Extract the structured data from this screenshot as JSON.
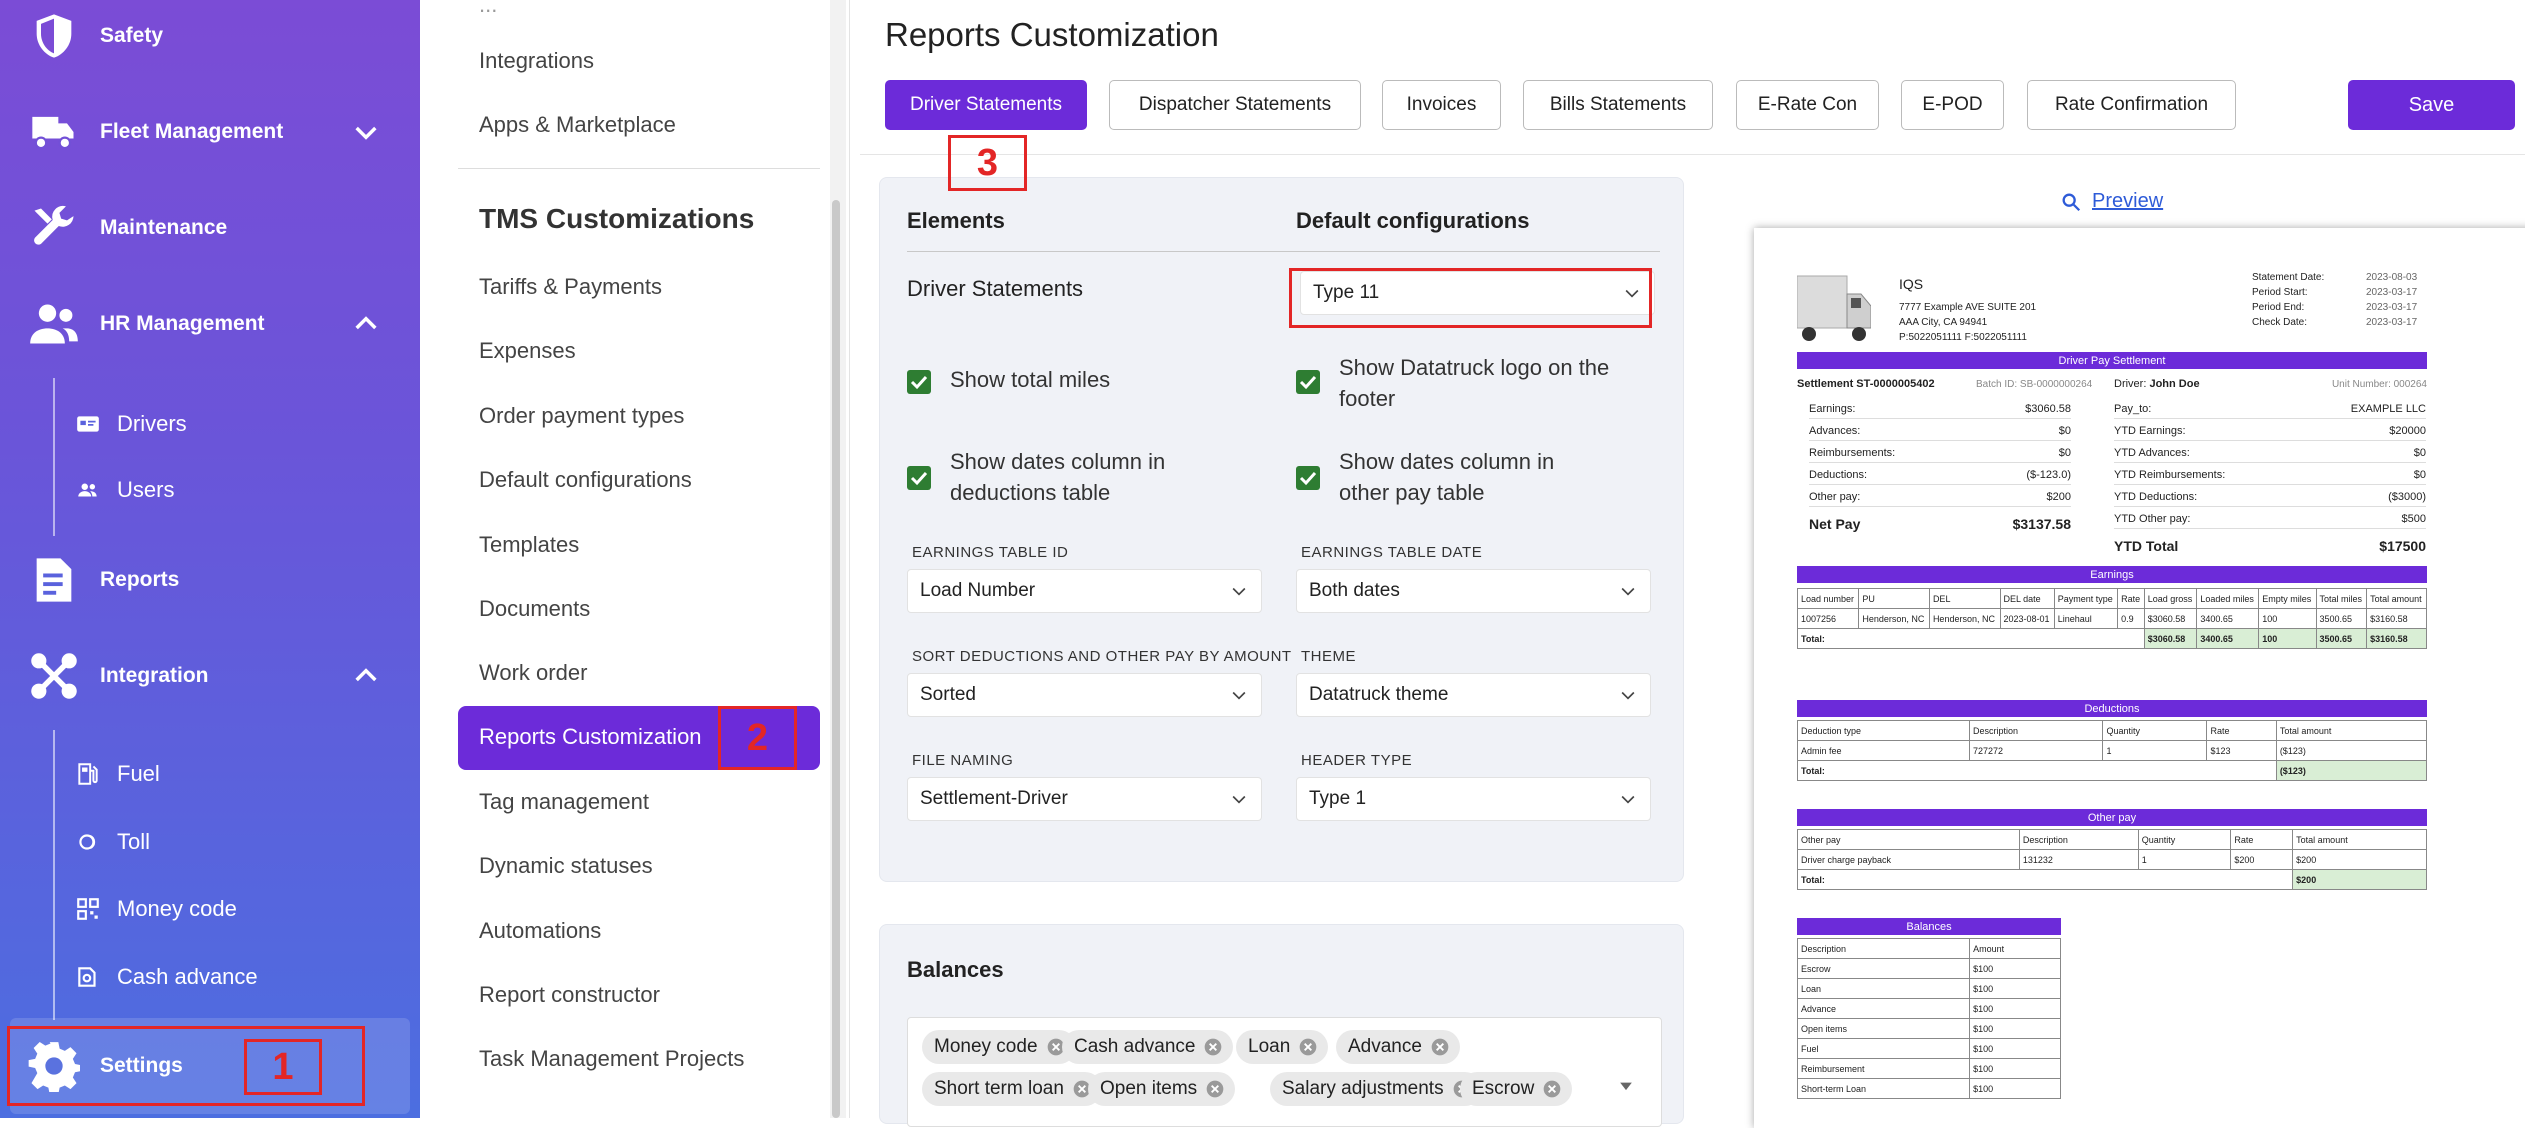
{
  "sidebar": {
    "items": [
      {
        "label": "Safety",
        "icon": "shield-icon"
      },
      {
        "label": "Fleet Management",
        "icon": "truck-icon"
      },
      {
        "label": "Maintenance",
        "icon": "wrench-icon"
      },
      {
        "label": "HR Management",
        "icon": "users-icon"
      },
      {
        "label": "Reports",
        "icon": "report-icon"
      },
      {
        "label": "Integration",
        "icon": "integration-icon"
      },
      {
        "label": "Settings",
        "icon": "gear-icon"
      }
    ],
    "hr_sub": [
      {
        "label": "Drivers",
        "icon": "id-card-icon"
      },
      {
        "label": "Users",
        "icon": "user-group-icon"
      }
    ],
    "integration_sub": [
      {
        "label": "Fuel",
        "icon": "fuel-icon"
      },
      {
        "label": "Toll",
        "icon": "toll-icon"
      },
      {
        "label": "Money code",
        "icon": "qr-code-icon"
      },
      {
        "label": "Cash advance",
        "icon": "cash-icon"
      }
    ]
  },
  "midnav": {
    "items_top": [
      "Integrations",
      "Apps & Marketplace"
    ],
    "section_title": "TMS Customizations",
    "items": [
      "Tariffs & Payments",
      "Expenses",
      "Order payment types",
      "Default configurations",
      "Templates",
      "Documents",
      "Work order",
      "Reports Customization",
      "Tag management",
      "Dynamic statuses",
      "Automations",
      "Report constructor",
      "Task Management Projects"
    ]
  },
  "main": {
    "title": "Reports Customization",
    "tabs": [
      "Driver Statements",
      "Dispatcher Statements",
      "Invoices",
      "Bills Statements",
      "E-Rate Con",
      "E-POD",
      "Rate Confirmation"
    ],
    "save_label": "Save",
    "config": {
      "col_elements": "Elements",
      "col_defaults": "Default configurations",
      "row_label": "Driver Statements",
      "type_value": "Type 11",
      "checks": [
        {
          "label": "Show total miles",
          "checked": true
        },
        {
          "label": "Show Datatruck logo on the footer",
          "checked": true
        },
        {
          "label": "Show dates column in deductions table",
          "checked": true
        },
        {
          "label": "Show dates column in other pay table",
          "checked": true
        }
      ],
      "fields": [
        {
          "label": "EARNINGS TABLE ID",
          "value": "Load Number"
        },
        {
          "label": "EARNINGS TABLE DATE",
          "value": "Both dates"
        },
        {
          "label": "SORT DEDUCTIONS AND OTHER PAY BY AMOUNT",
          "value": "Sorted"
        },
        {
          "label": "THEME",
          "value": "Datatruck theme"
        },
        {
          "label": "FILE NAMING",
          "value": "Settlement-Driver"
        },
        {
          "label": "HEADER TYPE",
          "value": "Type 1"
        }
      ]
    },
    "balances": {
      "title": "Balances",
      "chips": [
        "Money code",
        "Cash advance",
        "Loan",
        "Advance",
        "Short term loan",
        "Open items",
        "Salary adjustments",
        "Escrow"
      ]
    },
    "preview": {
      "link_label": "Preview",
      "company": "IQS",
      "address1": "7777 Example AVE SUITE 201",
      "address2": "AAA City, CA 94941",
      "phone": "P:5022051111 F:5022051111",
      "meta": [
        {
          "k": "Statement Date:",
          "v": "2023-08-03"
        },
        {
          "k": "Period Start:",
          "v": "2023-03-17"
        },
        {
          "k": "Period End:",
          "v": "2023-03-17"
        },
        {
          "k": "Check Date:",
          "v": "2023-03-17"
        }
      ],
      "settlement_bar": "Driver Pay Settlement",
      "settlement_no": "Settlement ST-0000005402",
      "batch": "Batch ID: SB-0000000264",
      "driver_label": "Driver:",
      "driver_name": "John Doe",
      "unit": "Unit Number: 000264",
      "left_kv": [
        {
          "k": "Earnings:",
          "v": "$3060.58"
        },
        {
          "k": "Advances:",
          "v": "$0"
        },
        {
          "k": "Reimbursements:",
          "v": "$0"
        },
        {
          "k": "Deductions:",
          "v": "($-123.0)"
        },
        {
          "k": "Other pay:",
          "v": "$200"
        }
      ],
      "net_pay": {
        "k": "Net Pay",
        "v": "$3137.58"
      },
      "right_kv": [
        {
          "k": "Pay_to:",
          "v": "EXAMPLE LLC"
        },
        {
          "k": "YTD Earnings:",
          "v": "$20000"
        },
        {
          "k": "YTD Advances:",
          "v": "$0"
        },
        {
          "k": "YTD Reimbursements:",
          "v": "$0"
        },
        {
          "k": "YTD Deductions:",
          "v": "($3000)"
        },
        {
          "k": "YTD Other pay:",
          "v": "$500"
        }
      ],
      "ytd_total": {
        "k": "YTD Total",
        "v": "$17500"
      },
      "earnings_bar": "Earnings",
      "earnings_head": [
        "Load number",
        "PU",
        "DEL",
        "DEL date",
        "Payment type",
        "Rate",
        "Load gross",
        "Loaded miles",
        "Empty miles",
        "Total miles",
        "Total amount"
      ],
      "earnings_row": [
        "1007256",
        "Henderson, NC",
        "Henderson, NC",
        "2023-08-01",
        "Linehaul",
        "0.9",
        "$3060.58",
        "3400.65",
        "100",
        "3500.65",
        "$3160.58"
      ],
      "earnings_total": [
        "Total:",
        "$3060.58",
        "3400.65",
        "100",
        "3500.65",
        "$3160.58"
      ],
      "deductions_bar": "Deductions",
      "ded_head": [
        "Deduction type",
        "Description",
        "Quantity",
        "Rate",
        "Total amount"
      ],
      "ded_row": [
        "Admin fee",
        "727272",
        "1",
        "$123",
        "($123)"
      ],
      "ded_total": [
        "Total:",
        "($123)"
      ],
      "otherpay_bar": "Other pay",
      "op_head": [
        "Other pay",
        "Description",
        "Quantity",
        "Rate",
        "Total amount"
      ],
      "op_row": [
        "Driver charge payback",
        "131232",
        "1",
        "$200",
        "$200"
      ],
      "op_total": [
        "Total:",
        "$200"
      ],
      "balances_bar": "Balances",
      "bal_head": [
        "Description",
        "Amount"
      ],
      "bal_rows": [
        [
          "Escrow",
          "$100"
        ],
        [
          "Loan",
          "$100"
        ],
        [
          "Advance",
          "$100"
        ],
        [
          "Open items",
          "$100"
        ],
        [
          "Fuel",
          "$100"
        ],
        [
          "Reimbursement",
          "$100"
        ],
        [
          "Short-term Loan",
          "$100"
        ]
      ]
    }
  },
  "annotations": [
    "1",
    "2",
    "3"
  ],
  "colors": {
    "accent": "#6c2bd9",
    "sidebar_top": "#7b4cd6",
    "sidebar_bottom": "#4c6ee0",
    "annotation": "#e32626",
    "check": "#2e7d32"
  }
}
